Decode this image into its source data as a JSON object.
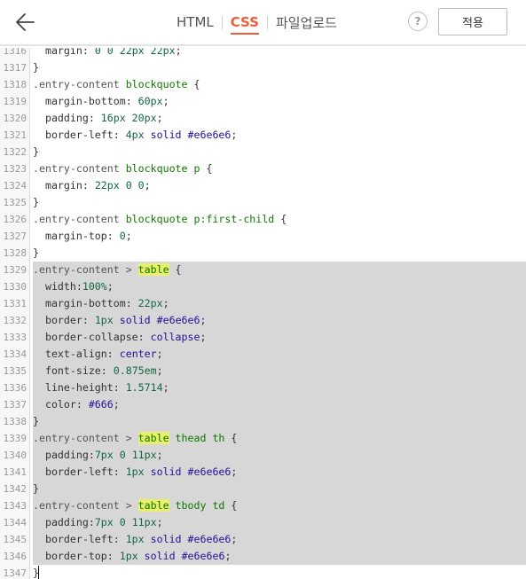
{
  "header": {
    "tabs": [
      {
        "label": "HTML",
        "active": false
      },
      {
        "label": "CSS",
        "active": true
      },
      {
        "label": "파일업로드",
        "active": false
      }
    ],
    "help_label": "?",
    "apply_label": "적용",
    "back_icon": "arrow-left-icon",
    "accent_color": "#ef5d3d"
  },
  "editor": {
    "highlight_word": "table",
    "lines": [
      {
        "n": "1316",
        "selected": false,
        "tokens": [
          [
            "p",
            "  margin: "
          ],
          [
            "num",
            "0 0 22px 22px"
          ],
          [
            "p",
            ";"
          ]
        ]
      },
      {
        "n": "1317",
        "selected": false,
        "tokens": [
          [
            "p",
            "}"
          ]
        ]
      },
      {
        "n": "1318",
        "selected": false,
        "tokens": [
          [
            "sel",
            ".entry-content "
          ],
          [
            "tag",
            "blockquote"
          ],
          [
            "p",
            " {"
          ]
        ]
      },
      {
        "n": "1319",
        "selected": false,
        "tokens": [
          [
            "p",
            "  margin-bottom: "
          ],
          [
            "num",
            "60px"
          ],
          [
            "p",
            ";"
          ]
        ]
      },
      {
        "n": "1320",
        "selected": false,
        "tokens": [
          [
            "p",
            "  padding: "
          ],
          [
            "num",
            "16px 20px"
          ],
          [
            "p",
            ";"
          ]
        ]
      },
      {
        "n": "1321",
        "selected": false,
        "tokens": [
          [
            "p",
            "  border-left: "
          ],
          [
            "num",
            "4px"
          ],
          [
            "p",
            " "
          ],
          [
            "str",
            "solid"
          ],
          [
            "p",
            " "
          ],
          [
            "str",
            "#e6e6e6"
          ],
          [
            "p",
            ";"
          ]
        ]
      },
      {
        "n": "1322",
        "selected": false,
        "tokens": [
          [
            "p",
            "}"
          ]
        ]
      },
      {
        "n": "1323",
        "selected": false,
        "tokens": [
          [
            "sel",
            ".entry-content "
          ],
          [
            "tag",
            "blockquote p"
          ],
          [
            "p",
            " {"
          ]
        ]
      },
      {
        "n": "1324",
        "selected": false,
        "tokens": [
          [
            "p",
            "  margin: "
          ],
          [
            "num",
            "22px 0 0"
          ],
          [
            "p",
            ";"
          ]
        ]
      },
      {
        "n": "1325",
        "selected": false,
        "tokens": [
          [
            "p",
            "}"
          ]
        ]
      },
      {
        "n": "1326",
        "selected": false,
        "tokens": [
          [
            "sel",
            ".entry-content "
          ],
          [
            "tag",
            "blockquote p:first-child"
          ],
          [
            "p",
            " {"
          ]
        ]
      },
      {
        "n": "1327",
        "selected": false,
        "tokens": [
          [
            "p",
            "  margin-top: "
          ],
          [
            "num",
            "0"
          ],
          [
            "p",
            ";"
          ]
        ]
      },
      {
        "n": "1328",
        "selected": false,
        "tokens": [
          [
            "p",
            "}"
          ]
        ]
      },
      {
        "n": "1329",
        "selected": true,
        "tokens": [
          [
            "sel",
            ".entry-content > "
          ],
          [
            "match",
            "table"
          ],
          [
            "p",
            " {"
          ]
        ]
      },
      {
        "n": "1330",
        "selected": true,
        "tokens": [
          [
            "p",
            "  width:"
          ],
          [
            "num",
            "100%"
          ],
          [
            "p",
            ";"
          ]
        ]
      },
      {
        "n": "1331",
        "selected": true,
        "tokens": [
          [
            "p",
            "  margin-bottom: "
          ],
          [
            "num",
            "22px"
          ],
          [
            "p",
            ";"
          ]
        ]
      },
      {
        "n": "1332",
        "selected": true,
        "tokens": [
          [
            "p",
            "  border: "
          ],
          [
            "num",
            "1px"
          ],
          [
            "p",
            " "
          ],
          [
            "str",
            "solid"
          ],
          [
            "p",
            " "
          ],
          [
            "str",
            "#e6e6e6"
          ],
          [
            "p",
            ";"
          ]
        ]
      },
      {
        "n": "1333",
        "selected": true,
        "tokens": [
          [
            "p",
            "  border-collapse: "
          ],
          [
            "str",
            "collapse"
          ],
          [
            "p",
            ";"
          ]
        ]
      },
      {
        "n": "1334",
        "selected": true,
        "tokens": [
          [
            "p",
            "  text-align: "
          ],
          [
            "str",
            "center"
          ],
          [
            "p",
            ";"
          ]
        ]
      },
      {
        "n": "1335",
        "selected": true,
        "tokens": [
          [
            "p",
            "  font-size: "
          ],
          [
            "num",
            "0.875em"
          ],
          [
            "p",
            ";"
          ]
        ]
      },
      {
        "n": "1336",
        "selected": true,
        "tokens": [
          [
            "p",
            "  line-height: "
          ],
          [
            "num",
            "1.5714"
          ],
          [
            "p",
            ";"
          ]
        ]
      },
      {
        "n": "1337",
        "selected": true,
        "tokens": [
          [
            "p",
            "  color: "
          ],
          [
            "str",
            "#666"
          ],
          [
            "p",
            ";"
          ]
        ]
      },
      {
        "n": "1338",
        "selected": true,
        "tokens": [
          [
            "p",
            "}"
          ]
        ]
      },
      {
        "n": "1339",
        "selected": true,
        "tokens": [
          [
            "sel",
            ".entry-content > "
          ],
          [
            "match",
            "table"
          ],
          [
            "tag",
            " thead th"
          ],
          [
            "p",
            " {"
          ]
        ]
      },
      {
        "n": "1340",
        "selected": true,
        "tokens": [
          [
            "p",
            "  padding:"
          ],
          [
            "num",
            "7px 0 11px"
          ],
          [
            "p",
            ";"
          ]
        ]
      },
      {
        "n": "1341",
        "selected": true,
        "tokens": [
          [
            "p",
            "  border-left: "
          ],
          [
            "num",
            "1px"
          ],
          [
            "p",
            " "
          ],
          [
            "str",
            "solid"
          ],
          [
            "p",
            " "
          ],
          [
            "str",
            "#e6e6e6"
          ],
          [
            "p",
            ";"
          ]
        ]
      },
      {
        "n": "1342",
        "selected": true,
        "tokens": [
          [
            "p",
            "}"
          ]
        ]
      },
      {
        "n": "1343",
        "selected": true,
        "tokens": [
          [
            "sel",
            ".entry-content > "
          ],
          [
            "match",
            "table"
          ],
          [
            "tag",
            " tbody td"
          ],
          [
            "p",
            " {"
          ]
        ]
      },
      {
        "n": "1344",
        "selected": true,
        "tokens": [
          [
            "p",
            "  padding:"
          ],
          [
            "num",
            "7px 0 11px"
          ],
          [
            "p",
            ";"
          ]
        ]
      },
      {
        "n": "1345",
        "selected": true,
        "tokens": [
          [
            "p",
            "  border-left: "
          ],
          [
            "num",
            "1px"
          ],
          [
            "p",
            " "
          ],
          [
            "str",
            "solid"
          ],
          [
            "p",
            " "
          ],
          [
            "str",
            "#e6e6e6"
          ],
          [
            "p",
            ";"
          ]
        ]
      },
      {
        "n": "1346",
        "selected": true,
        "tokens": [
          [
            "p",
            "  border-top: "
          ],
          [
            "num",
            "1px"
          ],
          [
            "p",
            " "
          ],
          [
            "str",
            "solid"
          ],
          [
            "p",
            " "
          ],
          [
            "str",
            "#e6e6e6"
          ],
          [
            "p",
            ";"
          ]
        ]
      },
      {
        "n": "1347",
        "selected": false,
        "cursor": true,
        "tokens": [
          [
            "p",
            "}"
          ]
        ]
      }
    ]
  }
}
